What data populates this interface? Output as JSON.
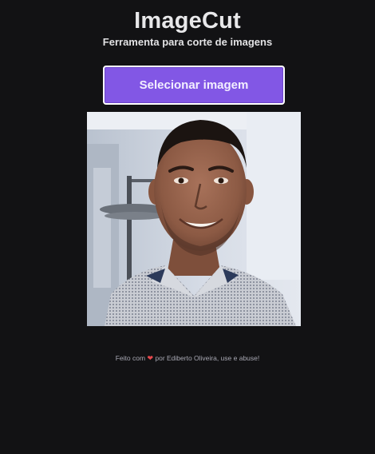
{
  "header": {
    "title": "ImageCut",
    "subtitle": "Ferramenta para corte de imagens"
  },
  "actions": {
    "select_label": "Selecionar imagem"
  },
  "preview": {
    "alt": "Foto de perfil recortada"
  },
  "footer": {
    "prefix": "Feito com",
    "heart": "❤",
    "suffix": "por Ediberto Oliveira, use e abuse!"
  },
  "colors": {
    "background": "#121214",
    "accent": "#8257e5",
    "heart": "#e5484d"
  },
  "icons": {
    "heart": "heart-icon"
  }
}
